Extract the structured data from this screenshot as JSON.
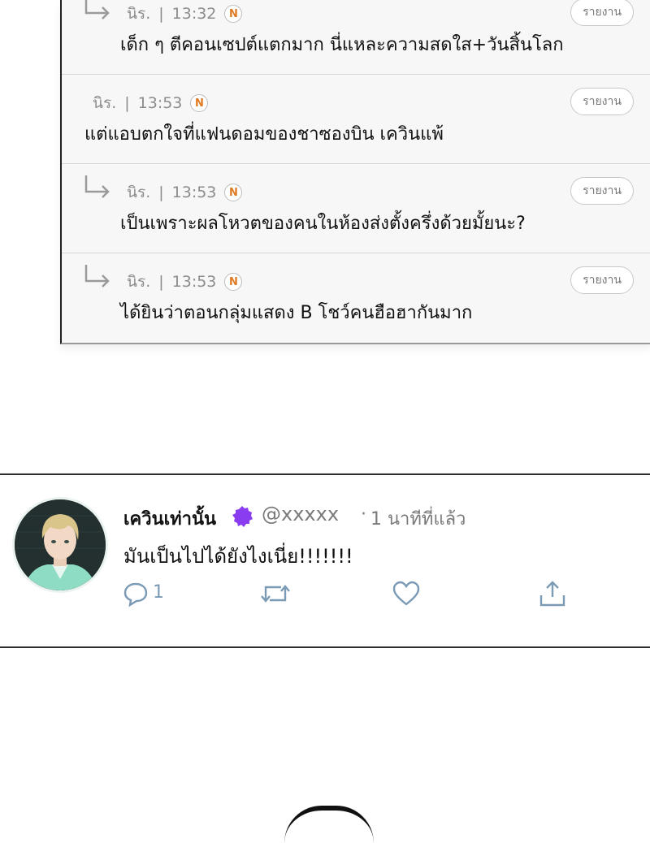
{
  "comments": [
    {
      "is_reply": true,
      "author": "นิร.",
      "separator": "|",
      "time": "13:32",
      "badge": "N",
      "report_label": "รายงาน",
      "text": "เด็ก ๆ ตีคอนเซปต์แตกมาก นี่แหละความสดใส+วันสิ้นโลก"
    },
    {
      "is_reply": false,
      "author": "นิร.",
      "separator": "|",
      "time": "13:53",
      "badge": "N",
      "report_label": "รายงาน",
      "text": "แต่แอบตกใจที่แฟนดอมของชาซองบิน เควินแพ้"
    },
    {
      "is_reply": true,
      "author": "นิร.",
      "separator": "|",
      "time": "13:53",
      "badge": "N",
      "report_label": "รายงาน",
      "text": "เป็นเพราะผลโหวตของคนในห้องส่งตั้งครึ่งด้วยมั้ยนะ?"
    },
    {
      "is_reply": true,
      "author": "นิร.",
      "separator": "|",
      "time": "13:53",
      "badge": "N",
      "report_label": "รายงาน",
      "text": "ได้ยินว่าตอนกลุ่มแสดง B โชว์คนฮือฮากันมาก"
    }
  ],
  "tweet": {
    "display_name": "เควินเท่านั้น",
    "handle": "@xxxxx",
    "dot": "·",
    "time_ago": "1 นาทีที่แล้ว",
    "body": "มันเป็นไปได้ยังไงเนี่ย!!!!!!!",
    "reply_count": "1",
    "verify_color": "#8a3df0",
    "action_color": "#7a9ab5"
  },
  "colors": {
    "badge_letter": "#e07a22"
  }
}
